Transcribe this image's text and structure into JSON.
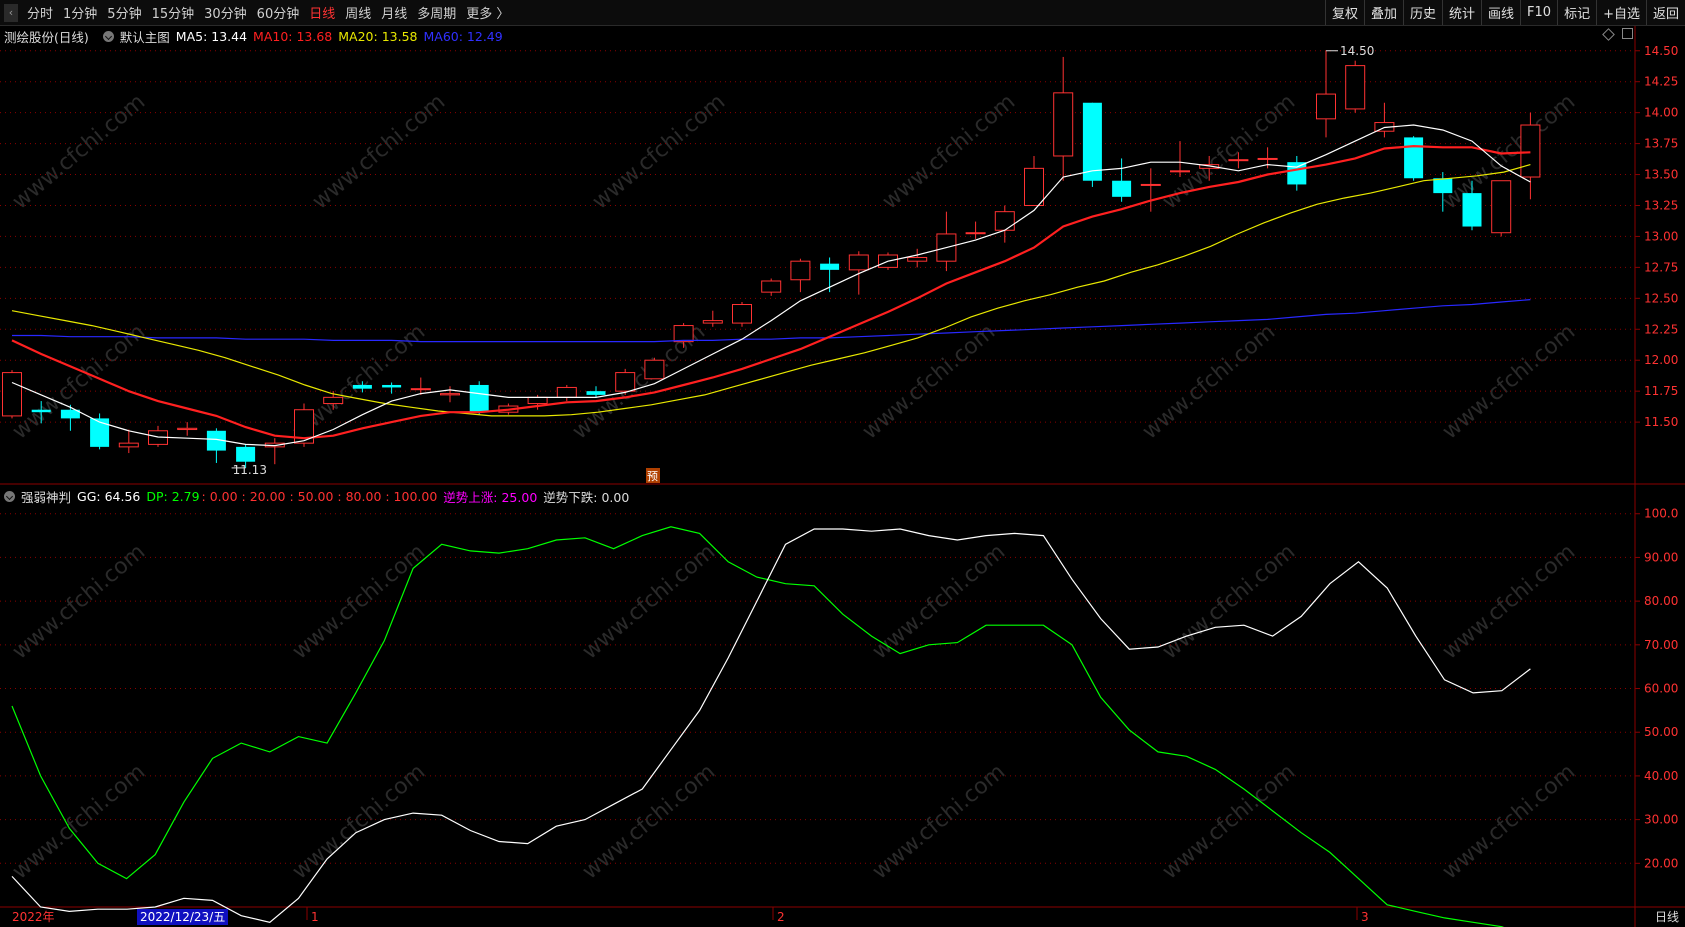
{
  "toolbar": {
    "periods": [
      "分时",
      "1分钟",
      "5分钟",
      "15分钟",
      "30分钟",
      "60分钟",
      "日线",
      "周线",
      "月线",
      "多周期",
      "更多 〉"
    ],
    "active_period": "日线",
    "right_buttons": [
      "复权",
      "叠加",
      "历史",
      "统计",
      "画线",
      "F10",
      "标记",
      "+自选",
      "返回"
    ]
  },
  "main_info": {
    "stock": "测绘股份(日线)",
    "template": "默认主图",
    "ma5_label": "MA5: 13.44",
    "ma10_label": "MA10: 13.68",
    "ma20_label": "MA20: 13.58",
    "ma60_label": "MA60: 12.49"
  },
  "indicator_info": {
    "name": "强弱神判",
    "gg": "GG: 64.56",
    "dp": "DP: 2.79",
    "levels": ": 0.00 : 20.00 : 50.00 : 80.00 : 100.00",
    "up": "逆势上涨: 25.00",
    "down": "逆势下跌: 0.00"
  },
  "annotations": {
    "high": "14.50",
    "low": "11.13",
    "pre": "预"
  },
  "x_labels": [
    "2022年",
    "1",
    "2",
    "3"
  ],
  "date_cursor": "2022/12/23/五",
  "period_tag": "日线",
  "watermark": "www.cfchi.com",
  "colors": {
    "up": "#ff3232",
    "down": "#00ffff",
    "ma5": "#ffffff",
    "ma10": "#ff2020",
    "ma20": "#e8e800",
    "ma60": "#2828ff",
    "gg": "#ffffff",
    "dp": "#00ff00",
    "grid": "#8b0000"
  },
  "chart_data": [
    {
      "type": "candlestick",
      "y_ticks": [
        "14.50",
        "14.25",
        "14.00",
        "13.75",
        "13.50",
        "13.25",
        "13.00",
        "12.75",
        "12.50",
        "12.25",
        "12.00",
        "11.75",
        "11.50"
      ],
      "ylim": [
        11.0,
        14.7
      ],
      "candles": [
        [
          11.55,
          11.9,
          11.92,
          11.53
        ],
        [
          11.6,
          11.58,
          11.67,
          11.49
        ],
        [
          11.6,
          11.53,
          11.64,
          11.43
        ],
        [
          11.53,
          11.3,
          11.57,
          11.28
        ],
        [
          11.3,
          11.33,
          11.44,
          11.25
        ],
        [
          11.32,
          11.43,
          11.47,
          11.3
        ],
        [
          11.44,
          11.45,
          11.5,
          11.39
        ],
        [
          11.43,
          11.27,
          11.45,
          11.17
        ],
        [
          11.3,
          11.18,
          11.32,
          11.13
        ],
        [
          11.3,
          11.33,
          11.37,
          11.16
        ],
        [
          11.33,
          11.6,
          11.65,
          11.3
        ],
        [
          11.65,
          11.7,
          11.75,
          11.6
        ],
        [
          11.8,
          11.77,
          11.83,
          11.74
        ],
        [
          11.8,
          11.78,
          11.82,
          11.73
        ],
        [
          11.77,
          11.77,
          11.86,
          11.72
        ],
        [
          11.72,
          11.73,
          11.79,
          11.66
        ],
        [
          11.8,
          11.58,
          11.83,
          11.56
        ],
        [
          11.58,
          11.63,
          11.65,
          11.56
        ],
        [
          11.65,
          11.7,
          11.72,
          11.6
        ],
        [
          11.7,
          11.78,
          11.8,
          11.67
        ],
        [
          11.75,
          11.72,
          11.79,
          11.7
        ],
        [
          11.75,
          11.9,
          11.93,
          11.72
        ],
        [
          11.85,
          12.0,
          12.02,
          11.85
        ],
        [
          12.15,
          12.28,
          12.3,
          12.1
        ],
        [
          12.3,
          12.32,
          12.4,
          12.27
        ],
        [
          12.3,
          12.45,
          12.47,
          12.27
        ],
        [
          12.55,
          12.64,
          12.66,
          12.52
        ],
        [
          12.65,
          12.8,
          12.82,
          12.55
        ],
        [
          12.78,
          12.73,
          12.83,
          12.55
        ],
        [
          12.73,
          12.85,
          12.88,
          12.53
        ],
        [
          12.75,
          12.85,
          12.87,
          12.73
        ],
        [
          12.8,
          12.83,
          12.9,
          12.75
        ],
        [
          12.8,
          13.02,
          13.2,
          12.72
        ],
        [
          13.03,
          13.03,
          13.12,
          12.98
        ],
        [
          13.05,
          13.2,
          13.25,
          12.95
        ],
        [
          13.25,
          13.55,
          13.65,
          13.25
        ],
        [
          13.65,
          14.16,
          14.45,
          13.45
        ],
        [
          14.08,
          13.45,
          14.08,
          13.4
        ],
        [
          13.45,
          13.32,
          13.63,
          13.28
        ],
        [
          13.42,
          13.42,
          13.55,
          13.2
        ],
        [
          13.53,
          13.53,
          13.77,
          13.48
        ],
        [
          13.55,
          13.58,
          13.65,
          13.45
        ],
        [
          13.62,
          13.62,
          13.68,
          13.55
        ],
        [
          13.63,
          13.63,
          13.72,
          13.55
        ],
        [
          13.6,
          13.42,
          13.65,
          13.37
        ],
        [
          13.95,
          14.15,
          14.5,
          13.8
        ],
        [
          14.03,
          14.38,
          14.42,
          14.0
        ],
        [
          13.85,
          13.92,
          14.08,
          13.8
        ],
        [
          13.8,
          13.47,
          13.81,
          13.45
        ],
        [
          13.47,
          13.35,
          13.52,
          13.2
        ],
        [
          13.35,
          13.08,
          13.45,
          13.05
        ],
        [
          13.03,
          13.45,
          13.45,
          13.0
        ],
        [
          13.48,
          13.9,
          14.0,
          13.3
        ]
      ],
      "ma5": [
        11.82,
        11.72,
        11.62,
        11.5,
        11.43,
        11.38,
        11.37,
        11.36,
        11.32,
        11.31,
        11.35,
        11.44,
        11.56,
        11.67,
        11.73,
        11.76,
        11.73,
        11.7,
        11.7,
        11.7,
        11.7,
        11.74,
        11.81,
        11.93,
        12.05,
        12.17,
        12.32,
        12.48,
        12.59,
        12.7,
        12.8,
        12.85,
        12.91,
        12.97,
        13.05,
        13.21,
        13.48,
        13.53,
        13.55,
        13.6,
        13.6,
        13.57,
        13.53,
        13.58,
        13.56,
        13.66,
        13.77,
        13.88,
        13.9,
        13.86,
        13.77,
        13.57,
        13.44
      ],
      "ma10": [
        12.16,
        12.05,
        11.95,
        11.85,
        11.75,
        11.67,
        11.61,
        11.55,
        11.46,
        11.39,
        11.37,
        11.39,
        11.45,
        11.5,
        11.55,
        11.58,
        11.58,
        11.6,
        11.63,
        11.66,
        11.67,
        11.7,
        11.74,
        11.8,
        11.86,
        11.93,
        12.01,
        12.09,
        12.19,
        12.29,
        12.39,
        12.5,
        12.62,
        12.71,
        12.8,
        12.91,
        13.08,
        13.16,
        13.22,
        13.29,
        13.35,
        13.4,
        13.44,
        13.5,
        13.54,
        13.58,
        13.63,
        13.71,
        13.73,
        13.72,
        13.72,
        13.67,
        13.68
      ],
      "ma20": [
        12.4,
        12.36,
        12.32,
        12.28,
        12.23,
        12.18,
        12.13,
        12.08,
        12.02,
        11.95,
        11.88,
        11.8,
        11.73,
        11.69,
        11.65,
        11.62,
        11.59,
        11.57,
        11.55,
        11.55,
        11.55,
        11.56,
        11.58,
        11.61,
        11.64,
        11.68,
        11.72,
        11.78,
        11.84,
        11.9,
        11.96,
        12.01,
        12.06,
        12.12,
        12.18,
        12.26,
        12.35,
        12.42,
        12.48,
        12.53,
        12.59,
        12.64,
        12.71,
        12.77,
        12.84,
        12.92,
        13.02,
        13.11,
        13.19,
        13.26,
        13.31,
        13.35,
        13.4,
        13.45,
        13.47,
        13.49,
        13.52,
        13.58
      ],
      "ma60": [
        12.2,
        12.2,
        12.19,
        12.19,
        12.19,
        12.18,
        12.18,
        12.18,
        12.17,
        12.17,
        12.17,
        12.16,
        12.16,
        12.16,
        12.15,
        12.15,
        12.15,
        12.15,
        12.15,
        12.15,
        12.15,
        12.15,
        12.15,
        12.16,
        12.16,
        12.17,
        12.17,
        12.18,
        12.18,
        12.19,
        12.2,
        12.21,
        12.22,
        12.23,
        12.24,
        12.25,
        12.26,
        12.27,
        12.28,
        12.29,
        12.3,
        12.31,
        12.32,
        12.33,
        12.35,
        12.37,
        12.38,
        12.4,
        12.42,
        12.44,
        12.45,
        12.47,
        12.49
      ]
    },
    {
      "type": "line",
      "y_ticks": [
        "100.0",
        "90.00",
        "80.00",
        "70.00",
        "60.00",
        "50.00",
        "40.00",
        "30.00",
        "20.00"
      ],
      "ylim": [
        10,
        102
      ],
      "series": [
        {
          "name": "GG",
          "values": [
            17,
            10,
            9,
            9.5,
            9.5,
            10,
            12,
            11.5,
            8,
            6.5,
            12,
            21,
            27,
            30,
            31.5,
            31,
            27.5,
            25,
            24.5,
            28.5,
            30,
            33.5,
            37,
            46,
            55,
            67,
            80,
            93,
            96.5,
            96.5,
            96,
            96.5,
            95,
            94,
            95,
            95.5,
            95,
            85,
            76,
            69,
            69.5,
            72,
            74,
            74.5,
            72,
            76.5,
            84,
            89,
            83,
            72,
            62,
            59,
            59.5,
            64.5
          ]
        },
        {
          "name": "DP",
          "values": [
            56,
            40,
            28,
            20,
            16.5,
            22,
            34,
            44,
            47.5,
            45.5,
            49,
            47.5,
            59,
            71,
            87.5,
            93,
            91.5,
            91,
            92,
            94,
            94.5,
            92,
            95,
            97,
            95.5,
            89,
            85.5,
            84,
            83.5,
            77,
            72,
            68,
            70,
            70.5,
            74.5,
            74.5,
            74.5,
            70,
            58,
            50.5,
            45.5,
            44.5,
            41.5,
            37,
            32,
            27,
            22.5,
            16.5,
            10.5,
            9,
            7.5,
            6.5,
            5.5,
            2.8
          ]
        }
      ]
    }
  ]
}
